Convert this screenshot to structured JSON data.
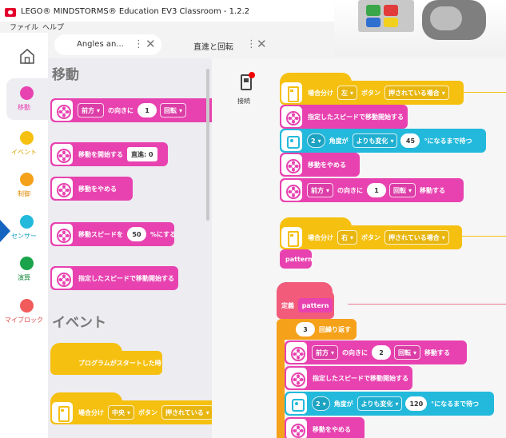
{
  "window": {
    "title": "LEGO® MINDSTORMS® Education EV3 Classroom - 1.2.2"
  },
  "menu": [
    "ファイル",
    "ヘルプ"
  ],
  "tabs": [
    {
      "label": "Angles an..."
    },
    {
      "label": "直進と回転"
    }
  ],
  "categories": [
    {
      "label": "移動",
      "color": "#e842b0"
    },
    {
      "label": "イベント",
      "color": "#f5c010"
    },
    {
      "label": "制御",
      "color": "#f5a11a"
    },
    {
      "label": "センサー",
      "color": "#22b9dc"
    },
    {
      "label": "演算",
      "color": "#1aa34a"
    },
    {
      "label": "マイブロック",
      "color": "#f25b5b"
    }
  ],
  "palette": {
    "head_move": "移動",
    "head_event": "イベント",
    "b1": {
      "dir": "前方",
      "mid": "の向きに",
      "num": "1",
      "unit": "回転"
    },
    "b2": {
      "text": "移動を開始する",
      "value": "直進: 0"
    },
    "b3": {
      "text": "移動をやめる"
    },
    "b4": {
      "pre": "移動スピードを",
      "num": "50",
      "post": "%にする"
    },
    "b5": {
      "text": "指定したスピードで移動開始する"
    },
    "b6": {
      "text": "プログラムがスタートした時"
    },
    "b7": {
      "pre": "場合分け",
      "dd": "中央",
      "mid": "ボタン",
      "dd2": "押されている"
    }
  },
  "canvas": {
    "connect_label": "接続",
    "s1": {
      "hat_pre": "場合分け",
      "hat_dd1": "左",
      "hat_mid": "ボタン",
      "hat_dd2": "押されている場合",
      "r1": "指定したスピードで移動開始する",
      "r2_port": "2",
      "r2_mid": "角度が",
      "r2_dd": "よりも変化",
      "r2_num": "45",
      "r2_post": "°になるまで待つ",
      "r3": "移動をやめる",
      "r4_dir": "前方",
      "r4_mid": "の向きに",
      "r4_num": "1",
      "r4_unit": "回転",
      "r4_post": "移動する"
    },
    "s2": {
      "hat_pre": "場合分け",
      "hat_dd1": "右",
      "hat_mid": "ボタン",
      "hat_dd2": "押されている場合",
      "call": "pattern"
    },
    "s3": {
      "def": "定義",
      "def_name": "pattern",
      "repeat_num": "3",
      "repeat_post": "回繰り返す",
      "r1_dir": "前方",
      "r1_mid": "の向きに",
      "r1_num": "2",
      "r1_unit": "回転",
      "r1_post": "移動する",
      "r2": "指定したスピードで移動開始する",
      "r3_port": "2",
      "r3_mid": "角度が",
      "r3_dd": "よりも変化",
      "r3_num": "120",
      "r3_post": "°になるまで待つ",
      "r4": "移動をやめる"
    }
  }
}
